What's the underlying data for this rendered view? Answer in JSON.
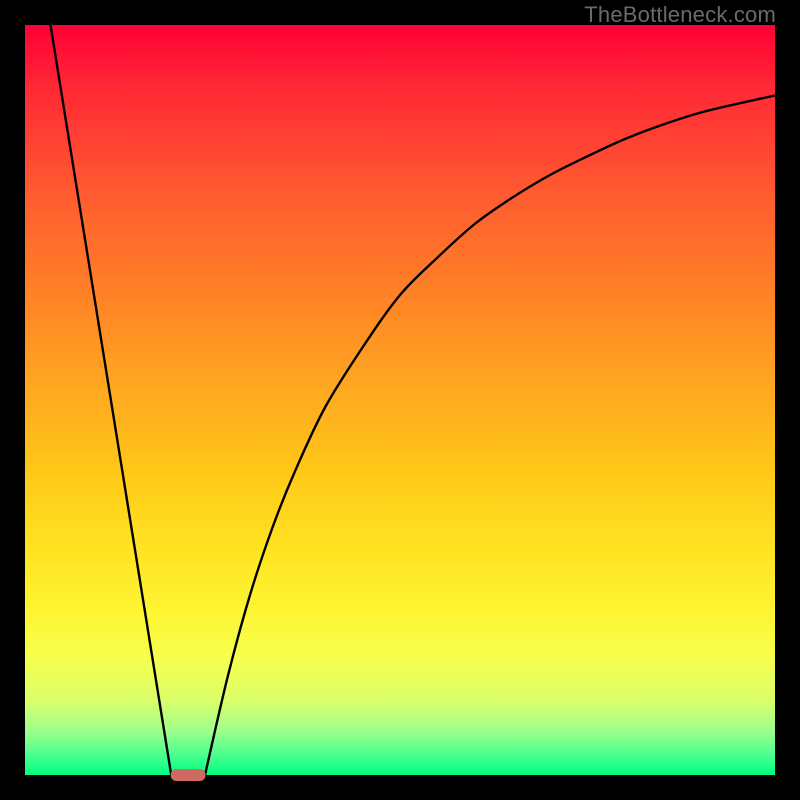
{
  "attribution": {
    "watermark": "TheBottleneck.com"
  },
  "chart_data": {
    "type": "line",
    "title": "",
    "xlabel": "",
    "ylabel": "",
    "xlim": [
      0,
      100
    ],
    "ylim": [
      0,
      100
    ],
    "grid": false,
    "legend": false,
    "series": [
      {
        "name": "left-branch",
        "description": "Steep descending line from top-left to the dip",
        "x": [
          3.4,
          19.5
        ],
        "y": [
          100,
          0
        ]
      },
      {
        "name": "right-branch",
        "description": "Rising saturating curve from the dip toward top-right",
        "x": [
          24,
          27,
          30,
          33,
          36,
          40,
          45,
          50,
          55,
          60,
          65,
          70,
          75,
          80,
          85,
          90,
          95,
          100
        ],
        "y": [
          0,
          13,
          24,
          33,
          40.5,
          49,
          57,
          64,
          69,
          73.5,
          77,
          80,
          82.5,
          84.8,
          86.7,
          88.3,
          89.5,
          90.6
        ]
      }
    ],
    "annotations": [
      {
        "name": "dip-marker",
        "shape": "rounded-rect",
        "x_range": [
          19.5,
          24
        ],
        "y": 0,
        "color": "#cf6a62"
      }
    ],
    "background_gradient": {
      "type": "vertical",
      "stops": [
        {
          "pos": 0.0,
          "color": "#ff0035"
        },
        {
          "pos": 0.36,
          "color": "#ff8226"
        },
        {
          "pos": 0.7,
          "color": "#ffe322"
        },
        {
          "pos": 0.9,
          "color": "#daff6a"
        },
        {
          "pos": 1.0,
          "color": "#00ff82"
        }
      ]
    }
  }
}
